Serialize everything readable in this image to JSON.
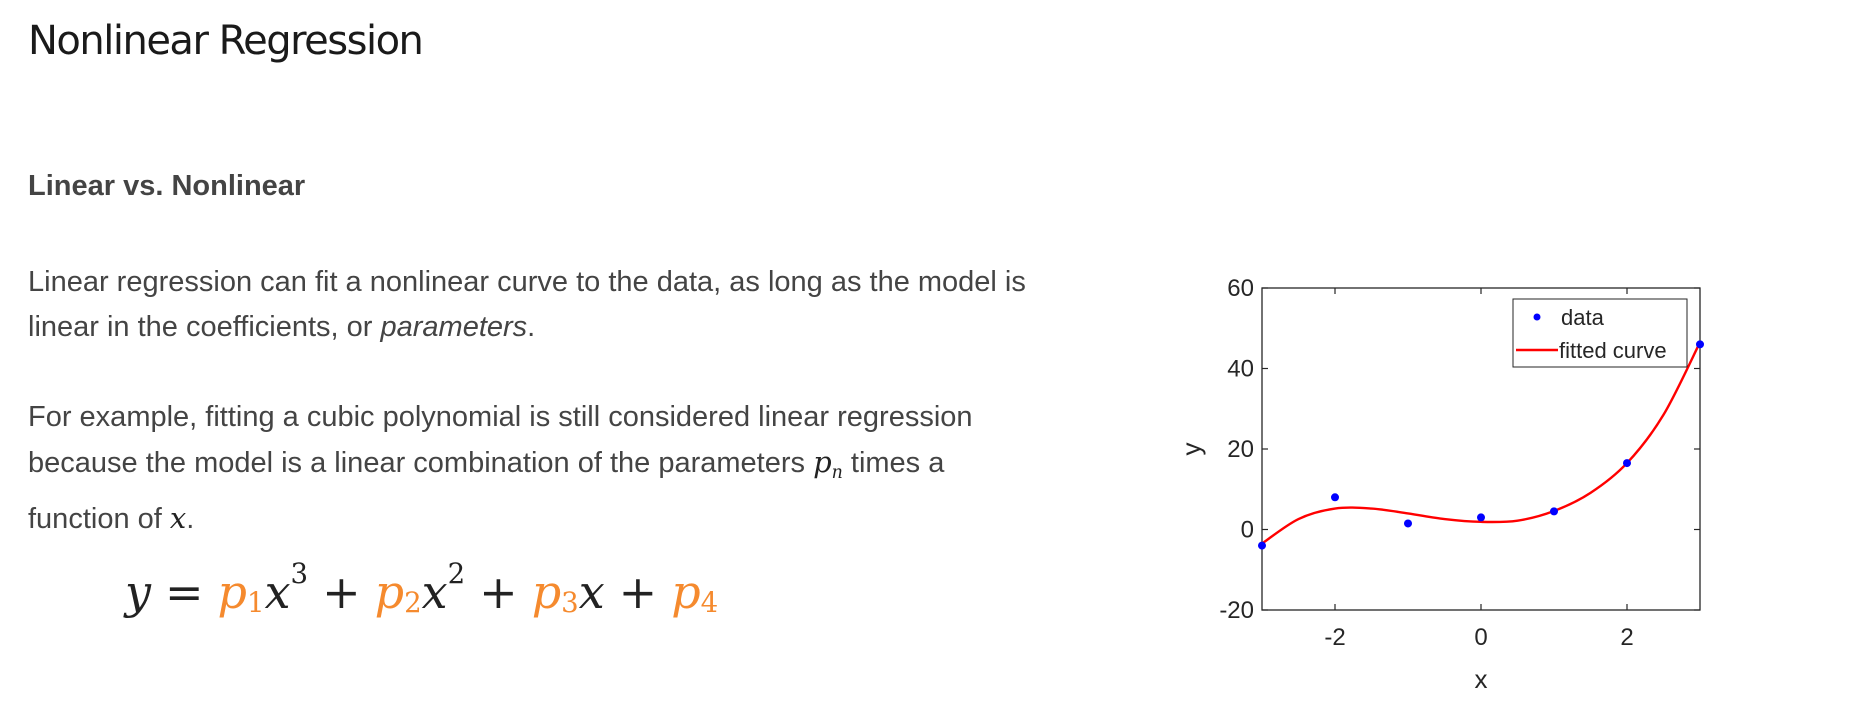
{
  "page": {
    "title": "Nonlinear Regression",
    "section_heading": "Linear vs. Nonlinear",
    "paragraph1": {
      "text_before": "Linear regression can fit a nonlinear curve to the data, as long as the model is linear in the coefficients, or ",
      "emphasis": "parameters",
      "text_after": "."
    },
    "paragraph2": {
      "text_before": "For example, fitting a cubic polynomial is still considered linear regression because the model is a linear combination of the parameters ",
      "var_p": "p",
      "var_p_sub": "n",
      "text_middle": " times a function of ",
      "var_x": "x",
      "text_after": "."
    },
    "equation": {
      "lhs": "y",
      "equals": "=",
      "plus": "+",
      "p": "p",
      "x": "x",
      "sub1": "1",
      "sub2": "2",
      "sub3": "3",
      "sub4": "4",
      "exp3": "3",
      "exp2": "2",
      "param_color": "#f58a2e"
    }
  },
  "chart_data": {
    "type": "scatter",
    "title": "",
    "xlabel": "x",
    "ylabel": "y",
    "xlim": [
      -3,
      3
    ],
    "ylim": [
      -20,
      60
    ],
    "xticks": [
      -2,
      0,
      2
    ],
    "yticks": [
      -20,
      0,
      20,
      40,
      60
    ],
    "legend_position": "top-right",
    "series": [
      {
        "name": "data",
        "kind": "points",
        "color": "#0000ff",
        "x": [
          -3,
          -2,
          -1,
          0,
          1,
          2,
          3
        ],
        "y": [
          -4,
          8,
          1.5,
          3,
          4.5,
          16.5,
          46
        ]
      },
      {
        "name": "fitted curve",
        "kind": "line",
        "color": "#ff0000",
        "x": [
          -3,
          -2.5,
          -2,
          -1.5,
          -1,
          -0.5,
          0,
          0.5,
          1,
          1.5,
          2,
          2.5,
          3
        ],
        "y": [
          -3.5,
          2.6,
          5.2,
          5.2,
          4.0,
          2.6,
          1.9,
          2.2,
          4.6,
          9.1,
          16.5,
          28.5,
          46.5
        ]
      }
    ]
  }
}
